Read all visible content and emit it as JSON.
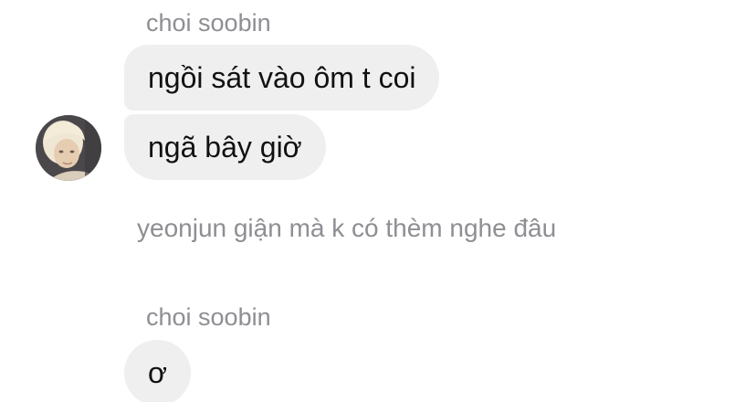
{
  "conversation": {
    "group1": {
      "sender": "choi soobin",
      "messages": [
        "ngồi sát vào ôm t coi",
        "ngã bây giờ"
      ]
    },
    "system_note": "yeonjun giận mà k có thèm nghe đâu",
    "group2": {
      "sender": "choi soobin",
      "messages": [
        "ơ"
      ]
    }
  },
  "colors": {
    "bubble_bg": "#efeff0",
    "secondary_text": "#8e8e93",
    "message_text": "#111111"
  },
  "icons": {
    "avatar": "profile-photo"
  }
}
